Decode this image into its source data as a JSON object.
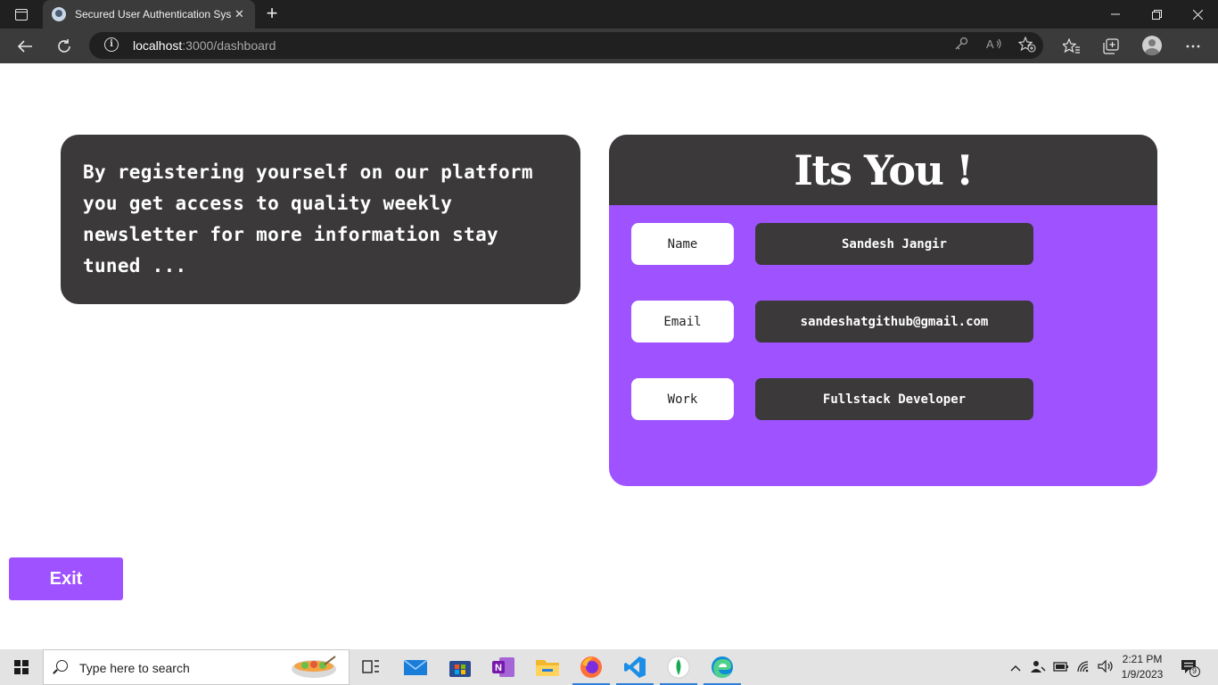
{
  "browser": {
    "tab_title": "Secured User Authentication Syst",
    "url_host": "localhost",
    "url_path": ":3000/dashboard",
    "new_tab_symbol": "+",
    "tab_close_symbol": "✕"
  },
  "page": {
    "intro_text": "By registering yourself on our platform you get access to quality weekly newsletter for more information stay tuned ...",
    "profile_title": "Its You !",
    "fields": [
      {
        "label": "Name",
        "value": "Sandesh Jangir"
      },
      {
        "label": "Email",
        "value": "sandeshatgithub@gmail.com"
      },
      {
        "label": "Work",
        "value": "Fullstack Developer"
      }
    ],
    "exit_label": "Exit"
  },
  "taskbar": {
    "search_placeholder": "Type here to search",
    "time": "2:21 PM",
    "date": "1/9/2023",
    "notification_count": "9"
  },
  "colors": {
    "accent": "#9f52ff",
    "card_dark": "#3b3939",
    "browser_dark": "#202020",
    "browser_toolbar": "#3b3b3b"
  },
  "icons": {
    "toolbar": [
      "back-icon",
      "refresh-icon",
      "info-icon",
      "key-icon",
      "read-aloud-icon",
      "add-favorite-icon",
      "favorites-icon",
      "collections-icon",
      "profile-avatar",
      "more-icon"
    ],
    "taskbar_apps": [
      "task-view-icon",
      "mail-icon",
      "store-icon",
      "onenote-icon",
      "file-explorer-icon",
      "firefox-icon",
      "vscode-icon",
      "mongodb-compass-icon",
      "edge-icon"
    ]
  }
}
